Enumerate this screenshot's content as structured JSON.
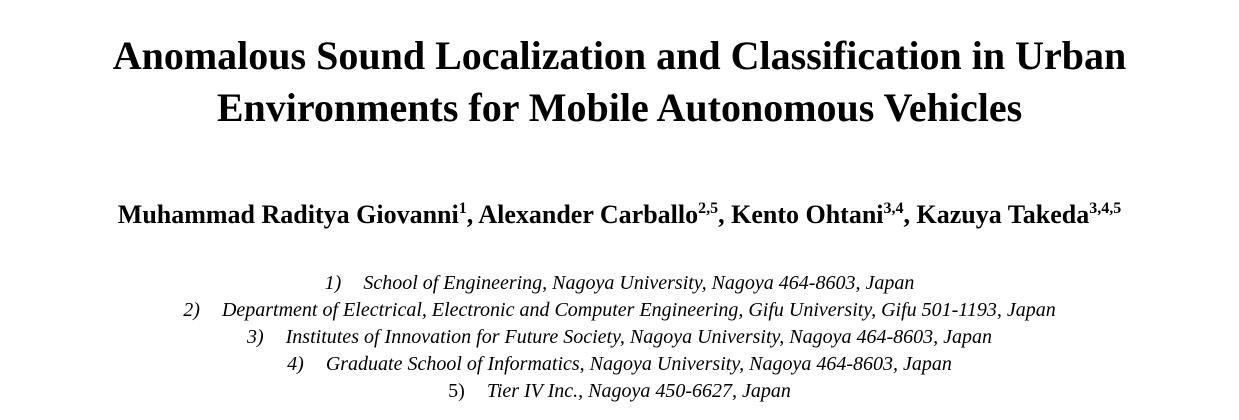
{
  "title": {
    "line1": "Anomalous Sound Localization and Classification in Urban",
    "line2": "Environments for Mobile Autonomous Vehicles"
  },
  "authors": [
    {
      "name": "Muhammad Raditya Giovanni",
      "sup": "1",
      "sep": ", "
    },
    {
      "name": "Alexander Carballo",
      "sup": "2,5",
      "sep": ", "
    },
    {
      "name": "Kento Ohtani",
      "sup": "3,4",
      "sep": ", "
    },
    {
      "name": "Kazuya Takeda",
      "sup": "3,4,5",
      "sep": ""
    }
  ],
  "affiliations": [
    {
      "num": "1)",
      "text": "School of Engineering, Nagoya University, Nagoya 464-8603, Japan"
    },
    {
      "num": "2)",
      "text": "Department of Electrical, Electronic and Computer Engineering, Gifu University, Gifu 501-1193, Japan"
    },
    {
      "num": "3)",
      "text": "Institutes of Innovation for Future Society, Nagoya University, Nagoya 464-8603, Japan"
    },
    {
      "num": "4)",
      "text": "Graduate School of Informatics, Nagoya University, Nagoya 464-8603, Japan"
    },
    {
      "num": "5)",
      "text": "Tier IV Inc., Nagoya 450-6627, Japan"
    }
  ]
}
